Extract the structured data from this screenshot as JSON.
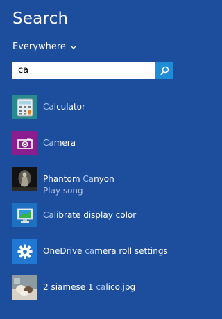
{
  "title": "Search",
  "scope": {
    "label": "Everywhere"
  },
  "search": {
    "value": "ca"
  },
  "results": [
    {
      "pre": "",
      "match": "Ca",
      "post": "lculator",
      "subtitle": "",
      "icon": "calculator-icon"
    },
    {
      "pre": "",
      "match": "Ca",
      "post": "mera",
      "subtitle": "",
      "icon": "camera-icon"
    },
    {
      "pre": "Phantom ",
      "match": "Ca",
      "post": "nyon",
      "subtitle": "Play song",
      "icon": "album-art-thumbnail"
    },
    {
      "pre": "",
      "match": "Ca",
      "post": "librate display color",
      "subtitle": "",
      "icon": "display-calibration-icon"
    },
    {
      "pre": "OneDrive ",
      "match": "ca",
      "post": "mera roll settings",
      "subtitle": "",
      "icon": "gear-icon"
    },
    {
      "pre": "2 siamese 1 ",
      "match": "ca",
      "post": "lico.jpg",
      "subtitle": "",
      "icon": "image-thumbnail"
    }
  ],
  "colors": {
    "background": "#1d4e9e",
    "search_button": "#1e8cd6",
    "match_highlight": "#a8c8f2",
    "calculator_tile": "#2b8a8f",
    "camera_tile": "#8a1e8f"
  }
}
